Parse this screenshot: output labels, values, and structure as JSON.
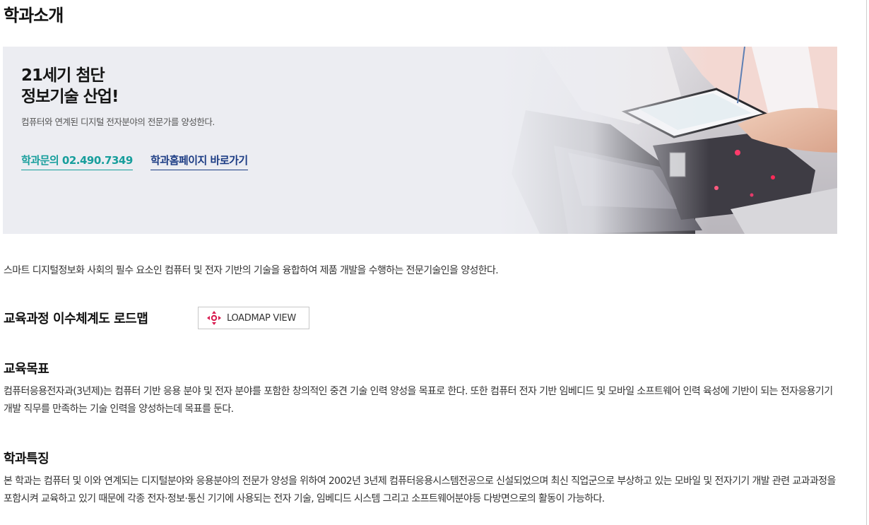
{
  "page": {
    "title": "학과소개"
  },
  "hero": {
    "title_line1": "21세기 첨단",
    "title_line2": "정보기술 산업!",
    "subtitle": "컴퓨터와 연계된 디지털 전자분야의 전문가를 양성한다.",
    "phone_link": "학과문의 02.490.7349",
    "homepage_link": "학과홈페이지 바로가기"
  },
  "intro": "스마트 디지털정보화 사회의 필수 요소인 컴퓨터 및 전자 기반의 기술을 융합하여 제품 개발을 수행하는 전문기술인을 양성한다.",
  "roadmap": {
    "heading": "교육과정 이수체계도 로드맵",
    "button_label": "LOADMAP VIEW",
    "button_icon": "move-arrows-icon"
  },
  "goal": {
    "heading": "교육목표",
    "text": "컴퓨터응용전자과(3년제)는 컴퓨터 기반 응용 분야 및 전자 분야를 포함한 창의적인 중견 기술 인력 양성을 목표로 한다. 또한 컴퓨터 전자 기반 임베디드 및 모바일 소프트웨어 인력 육성에 기반이 되는 전자응용기기 개발 직무를 만족하는 기술 인력을 양성하는데 목표를 둔다."
  },
  "features": {
    "heading": "학과특징",
    "text": "본 학과는 컴퓨터 및 이와 연계되는 디지털분야와 응용분야의 전문가 양성을 위하여 2002년 3년제 컴퓨터응용시스템전공으로 신설되었으며 최신 직업군으로 부상하고 있는 모바일 및 전자기기 개발 관련 교과과정을 포함시켜 교육하고 있기 때문에 각종 전자·정보·통신 기기에 사용되는 전자 기술, 임베디드 시스템 그리고 소프트웨어분야등 다방면으로의 활동이 가능하다."
  },
  "colors": {
    "accent_teal": "#179e9c",
    "accent_navy": "#1c3c84",
    "icon_red": "#d81b4f",
    "hero_bg": "#ecedf2"
  }
}
